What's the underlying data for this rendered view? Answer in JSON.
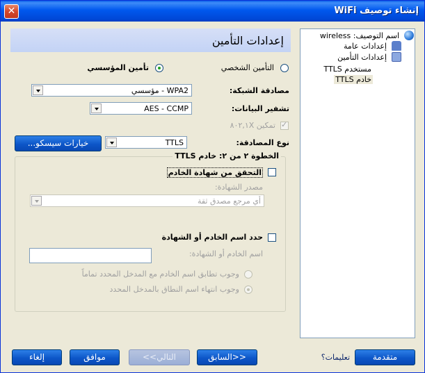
{
  "window": {
    "title": "إنشاء توصيف WiFi",
    "close": "✕"
  },
  "header": {
    "title": "إعدادات التأمين"
  },
  "security_type": {
    "personal_label": "التأمين الشخصي",
    "enterprise_label": "تأمين المؤسسي",
    "selected": "enterprise"
  },
  "network_auth": {
    "label": "مصادقة الشبكة:",
    "value": "WPA2 - مؤسسي"
  },
  "data_encryption": {
    "label": "تشفير البيانات:",
    "value": "AES - CCMP"
  },
  "enable_8021x": {
    "label": "تمكين ٨٠٢,١X",
    "checked": true
  },
  "auth_type": {
    "label": "نوع المصادقة:",
    "value": "TTLS",
    "cisco_button": "خيارات سيسكو..."
  },
  "step_group": {
    "title": "الخطوة ٢ من ٢: خادم TTLS",
    "verify_cert_label": "التحقق من شهادة الخادم",
    "cert_source_label": "مصدر الشهادة:",
    "cert_source_value": "أي مرجع مصدق ثقة",
    "specify_server_label": "حدد اسم الخادم أو الشهادة",
    "server_name_label": "اسم الخادم أو الشهادة:",
    "server_name_value": "",
    "match_exact_label": "وجوب تطابق اسم الخادم مع المدخل المحدد تماماً",
    "domain_end_label": "وجوب انتهاء اسم النطاق بالمدخل المحدد"
  },
  "tree": {
    "items": [
      {
        "label": "اسم التوصيف: wireless",
        "icon": "globe-icon"
      },
      {
        "label": "إعدادات عامة",
        "icon": "people-icon"
      },
      {
        "label": "إعدادات التأمين",
        "icon": "lock-icon"
      },
      {
        "label": "مستخدم TTLS",
        "icon": ""
      },
      {
        "label": "خادم TTLS",
        "icon": ""
      }
    ]
  },
  "footer": {
    "advanced": "متقدمة",
    "help": "تعليمات؟",
    "back": "<<السابق",
    "next": "التالي>>",
    "ok": "موافق",
    "cancel": "إلغاء"
  }
}
